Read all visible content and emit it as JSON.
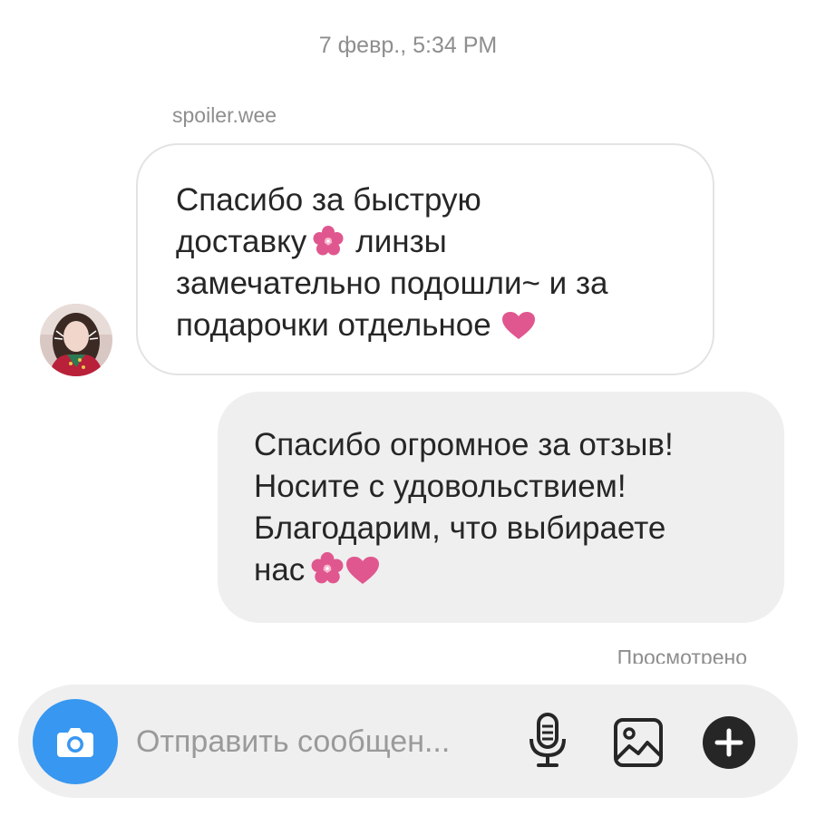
{
  "thread": {
    "timestamp": "7 февр., 5:34 PM",
    "sender_name": "spoiler.wee",
    "incoming": {
      "lines": [
        "Спасибо за быструю",
        "доставку",
        "линзы",
        "замечательно подошли~ и за",
        "подарочки отдельное"
      ],
      "avatar": "avatar-photo"
    },
    "outgoing": {
      "lines": [
        "Спасибо огромное за отзыв!",
        "Носите с удовольствием!",
        "Благодарим, что выбираете",
        "нас"
      ]
    },
    "seen_label": "Просмотрено"
  },
  "composer": {
    "placeholder": "Отправить сообщен...",
    "camera_icon": "camera-icon",
    "mic_icon": "microphone-icon",
    "gallery_icon": "gallery-icon",
    "plus_icon": "plus-icon"
  },
  "colors": {
    "accent": "#3897f0",
    "emoji_pink": "#e0578f",
    "incoming_border": "#e3e3e3",
    "outgoing_bg": "#efefef",
    "muted_text": "#8e8e8e"
  }
}
